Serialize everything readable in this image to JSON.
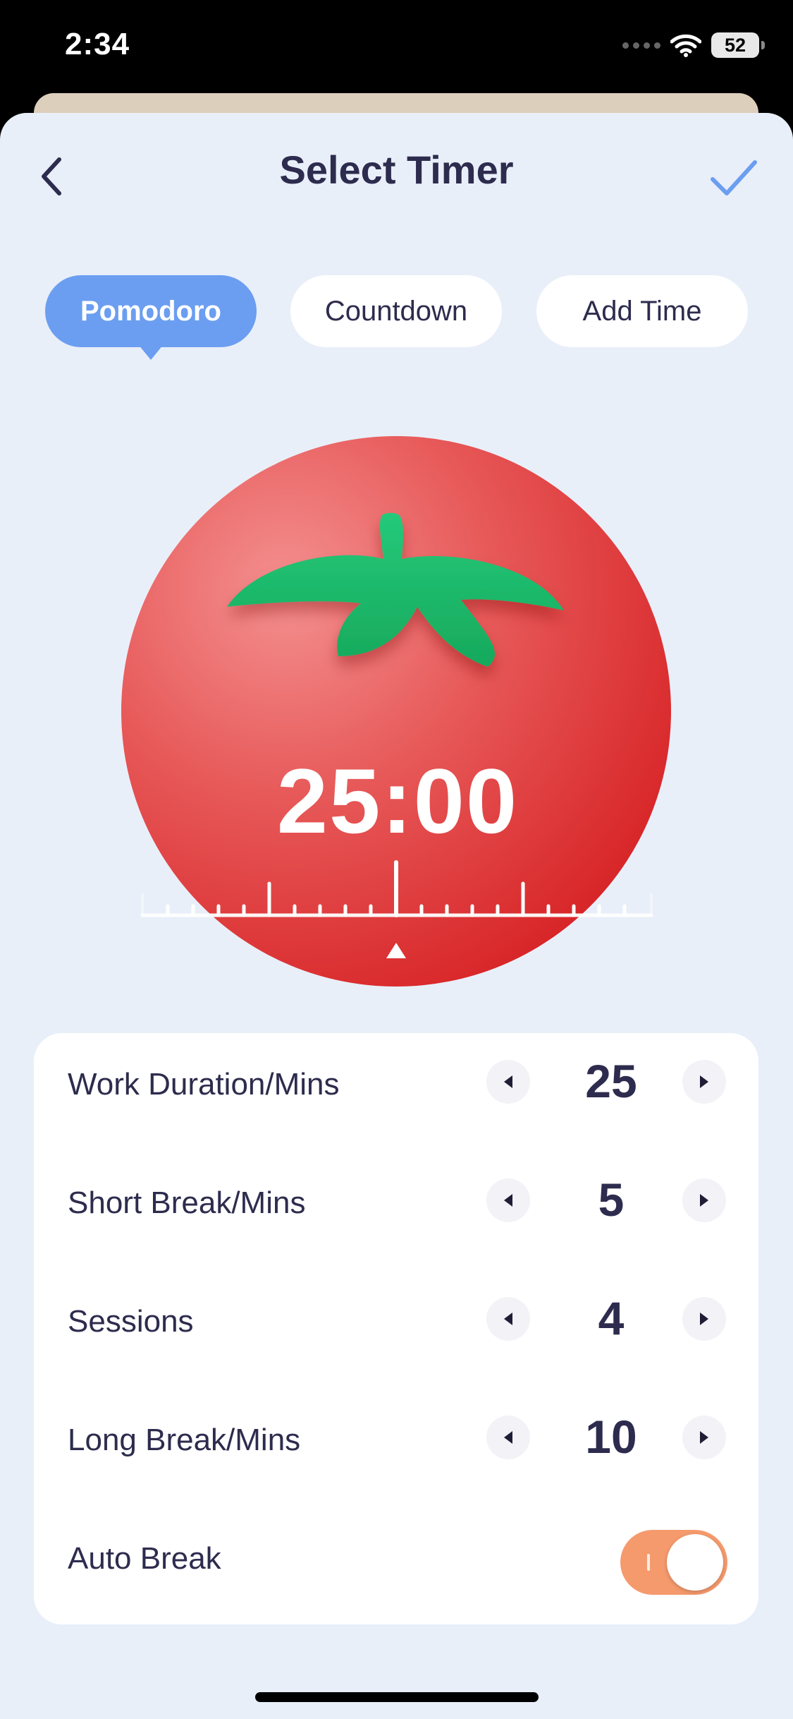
{
  "status_bar": {
    "time": "2:34",
    "battery": "52"
  },
  "header": {
    "title": "Select Timer"
  },
  "tabs": [
    {
      "label": "Pomodoro",
      "active": true
    },
    {
      "label": "Countdown",
      "active": false
    },
    {
      "label": "Add Time",
      "active": false
    }
  ],
  "timer": {
    "display": "25:00"
  },
  "settings": {
    "work_duration": {
      "label": "Work Duration/Mins",
      "value": "25"
    },
    "short_break": {
      "label": "Short Break/Mins",
      "value": "5"
    },
    "sessions": {
      "label": "Sessions",
      "value": "4"
    },
    "long_break": {
      "label": "Long Break/Mins",
      "value": "10"
    },
    "auto_break": {
      "label": "Auto Break",
      "enabled": true
    }
  },
  "colors": {
    "accent": "#6b9ef0",
    "tomato_red": "#e23b3b",
    "leaf_green": "#1fb86a",
    "toggle_on": "#f59a6d",
    "text": "#2d2c4e",
    "background": "#e9eff9"
  },
  "icons": {
    "back": "chevron-left-icon",
    "confirm": "checkmark-icon",
    "decrement": "triangle-left-icon",
    "increment": "triangle-right-icon",
    "wifi": "wifi-icon",
    "battery": "battery-icon"
  }
}
